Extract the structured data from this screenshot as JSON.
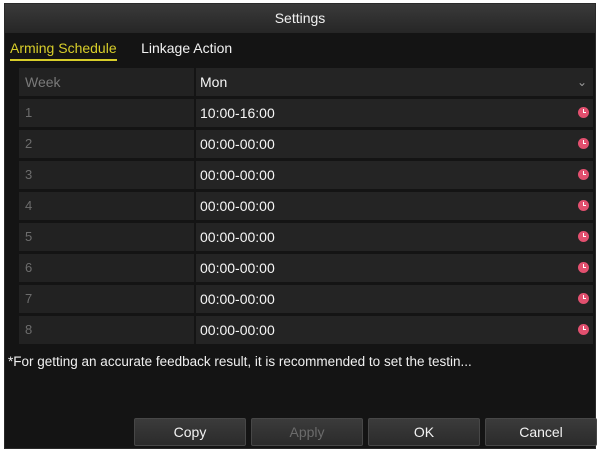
{
  "window": {
    "title": "Settings"
  },
  "tabs": [
    {
      "label": "Arming Schedule",
      "active": true
    },
    {
      "label": "Linkage Action",
      "active": false
    }
  ],
  "week": {
    "label": "Week",
    "value": "Mon"
  },
  "periods": [
    {
      "index": "1",
      "time": "10:00-16:00"
    },
    {
      "index": "2",
      "time": "00:00-00:00"
    },
    {
      "index": "3",
      "time": "00:00-00:00"
    },
    {
      "index": "4",
      "time": "00:00-00:00"
    },
    {
      "index": "5",
      "time": "00:00-00:00"
    },
    {
      "index": "6",
      "time": "00:00-00:00"
    },
    {
      "index": "7",
      "time": "00:00-00:00"
    },
    {
      "index": "8",
      "time": "00:00-00:00"
    }
  ],
  "note": "*For getting an accurate feedback result, it is recommended to set the testin...",
  "buttons": {
    "copy": "Copy",
    "apply": "Apply",
    "ok": "OK",
    "cancel": "Cancel"
  },
  "colors": {
    "accent": "#d8ce2a",
    "clock_icon": "#e2506f",
    "background": "#141414"
  }
}
